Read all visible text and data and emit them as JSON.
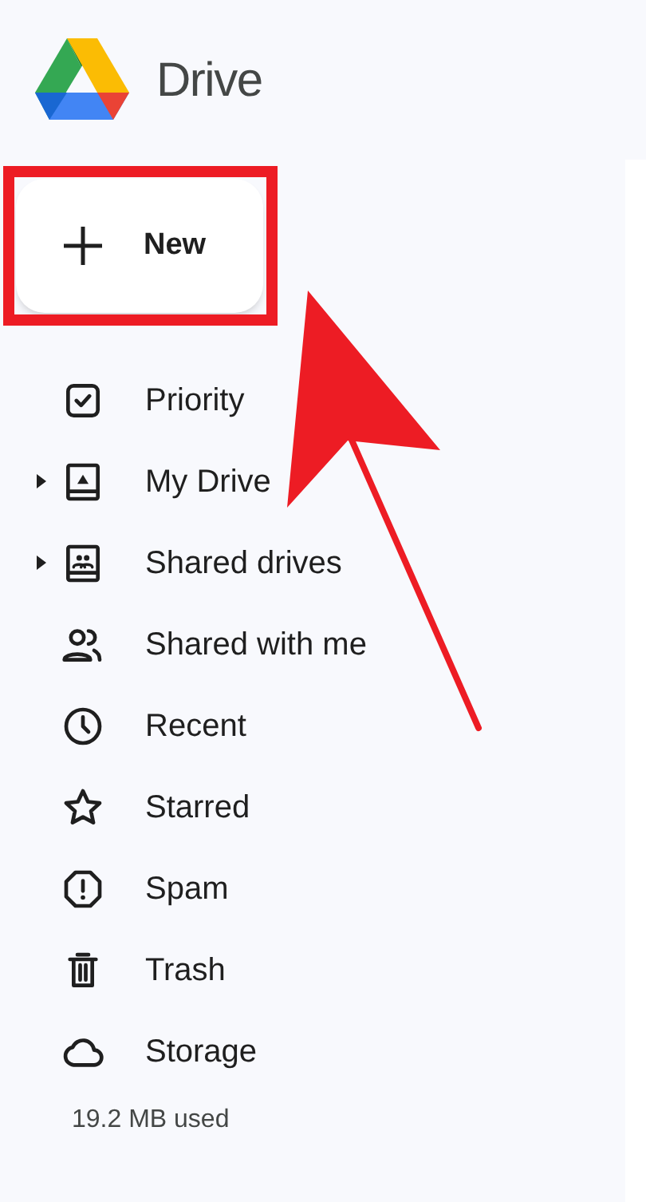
{
  "app": {
    "name": "Drive"
  },
  "new_button": {
    "label": "New"
  },
  "nav": [
    {
      "label": "Priority",
      "expandable": false
    },
    {
      "label": "My Drive",
      "expandable": true
    },
    {
      "label": "Shared drives",
      "expandable": true
    },
    {
      "label": "Shared with me",
      "expandable": false
    },
    {
      "label": "Recent",
      "expandable": false
    },
    {
      "label": "Starred",
      "expandable": false
    },
    {
      "label": "Spam",
      "expandable": false
    },
    {
      "label": "Trash",
      "expandable": false
    },
    {
      "label": "Storage",
      "expandable": false
    }
  ],
  "storage": {
    "used": "19.2 MB used"
  }
}
